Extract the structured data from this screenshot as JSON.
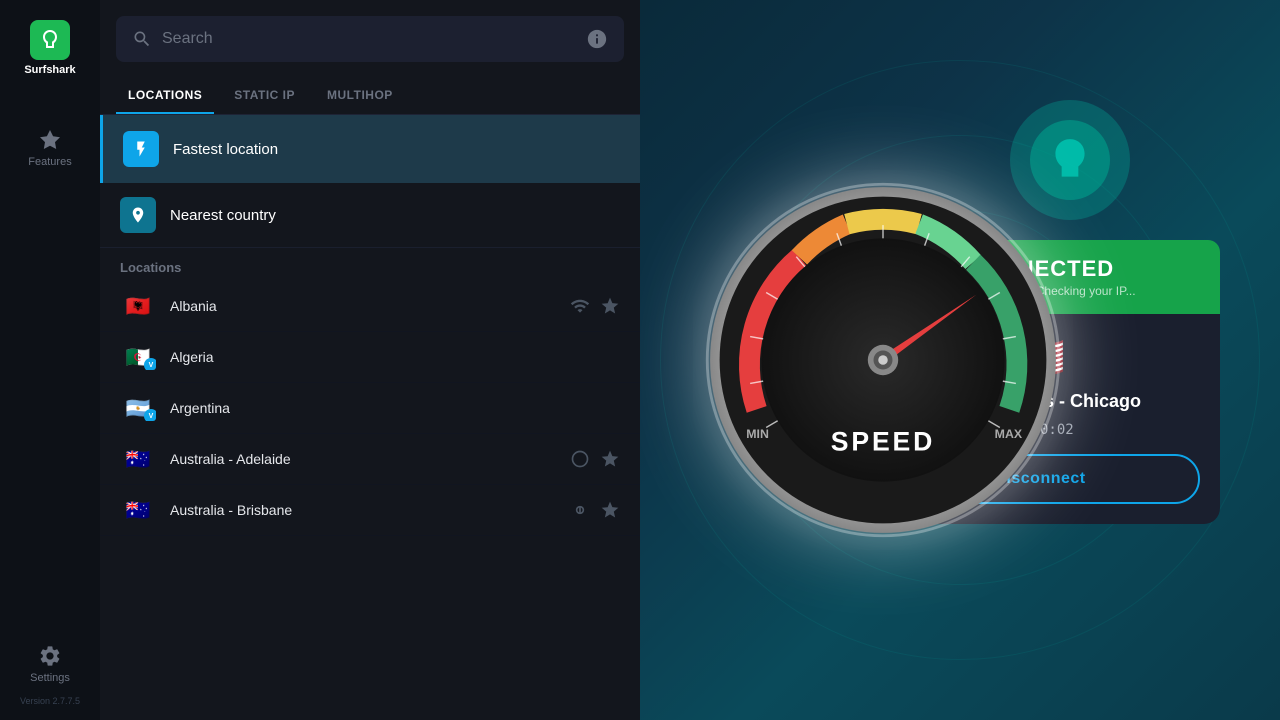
{
  "app": {
    "name": "Surfshark",
    "version": "Version 2.7.7.5"
  },
  "sidebar": {
    "features_label": "Features",
    "settings_label": "Settings"
  },
  "search": {
    "placeholder": "Search"
  },
  "tabs": [
    {
      "id": "locations",
      "label": "LOCATIONS",
      "active": true
    },
    {
      "id": "static-ip",
      "label": "STATIC IP",
      "active": false
    },
    {
      "id": "multihop",
      "label": "MULTIHOP",
      "active": false
    }
  ],
  "special_locations": [
    {
      "id": "fastest",
      "label": "Fastest location",
      "icon": "bolt"
    },
    {
      "id": "nearest",
      "label": "Nearest country",
      "icon": "location"
    }
  ],
  "sections": [
    {
      "header": "Locations",
      "countries": [
        {
          "name": "Albania",
          "flag": "🇦🇱",
          "has_badge": false
        },
        {
          "name": "Algeria",
          "flag": "🇩🇿",
          "has_badge": true
        },
        {
          "name": "Argentina",
          "flag": "🇦🇷",
          "has_badge": true
        },
        {
          "name": "Australia - Adelaide",
          "flag": "🇦🇺",
          "has_badge": false
        },
        {
          "name": "Australia - Brisbane",
          "flag": "🇦🇺",
          "has_badge": false
        }
      ]
    }
  ],
  "connection": {
    "status": "CONNECTED",
    "ip_text": "Your IP address: Checking your IP...",
    "flag": "🇺🇸",
    "location": "United States - Chicago",
    "time": "00:00:02",
    "disconnect_label": "Disconnect"
  },
  "speedometer": {
    "label": "SPEED"
  }
}
